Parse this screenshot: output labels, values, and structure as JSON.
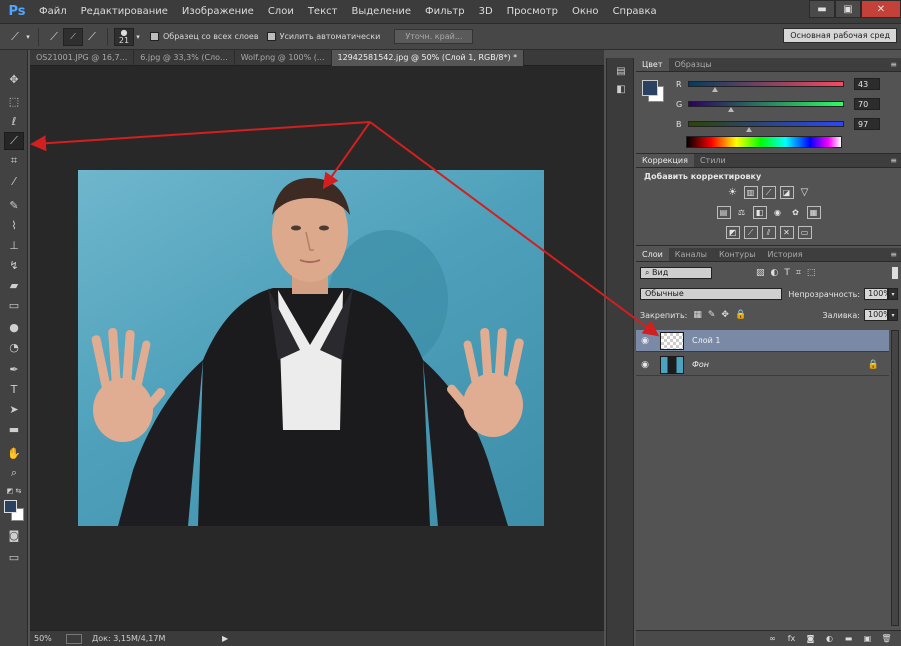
{
  "app": {
    "logo": "Ps"
  },
  "menu": [
    "Файл",
    "Редактирование",
    "Изображение",
    "Слои",
    "Текст",
    "Выделение",
    "Фильтр",
    "3D",
    "Просмотр",
    "Окно",
    "Справка"
  ],
  "window_buttons": {
    "minimize": "▬",
    "maximize": "▣",
    "close": "✕"
  },
  "options_bar": {
    "brush_size": "21",
    "sample_all_layers": "Образец со всех слоев",
    "auto_enhance": "Усилить автоматически",
    "refine_edge": "Уточн. край...",
    "workspace": "Основная рабочая сред"
  },
  "tabs": [
    {
      "label": "OS21001.JPG @ 16,7..."
    },
    {
      "label": "6.jpg @ 33,3% (Сло..."
    },
    {
      "label": "Wolf.png @ 100% (..."
    },
    {
      "label": "12942581542.jpg @ 50% (Слой 1, RGB/8*) *"
    }
  ],
  "status": {
    "zoom": "50%",
    "doc": "Док: 3,15M/4,17M"
  },
  "color_panel": {
    "tabs": [
      "Цвет",
      "Образцы"
    ],
    "r": {
      "label": "R",
      "value": "43"
    },
    "g": {
      "label": "G",
      "value": "70"
    },
    "b": {
      "label": "B",
      "value": "97"
    },
    "fg_color": "#2b4161",
    "bg_color": "#ffffff"
  },
  "adjust_panel": {
    "tabs": [
      "Коррекция",
      "Стили"
    ],
    "title": "Добавить корректировку"
  },
  "layers_panel": {
    "tabs": [
      "Слои",
      "Каналы",
      "Контуры",
      "История"
    ],
    "filter": "Вид",
    "blend_mode": "Обычные",
    "opacity_label": "Непрозрачность:",
    "opacity_value": "100%",
    "lock_label": "Закрепить:",
    "fill_label": "Заливка:",
    "fill_value": "100%",
    "layers": [
      {
        "name": "Слой 1"
      },
      {
        "name": "Фон"
      }
    ]
  },
  "colors": {
    "arrow": "#d21f1f",
    "accent_selected": "#7a8aa6"
  }
}
